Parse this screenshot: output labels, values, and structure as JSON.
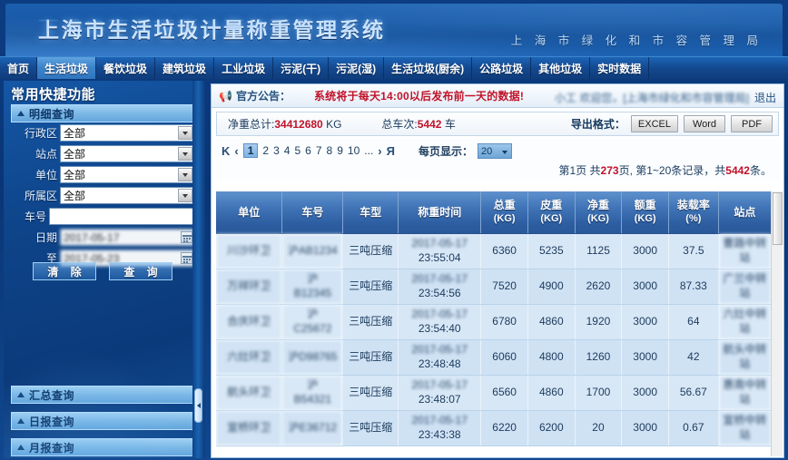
{
  "banner": {
    "title": "上海市生活垃圾计量称重管理系统",
    "org": "上 海 市 绿 化 和 市 容 管 理 局"
  },
  "nav": {
    "items": [
      {
        "label": "首页",
        "active": false
      },
      {
        "label": "生活垃圾",
        "active": true
      },
      {
        "label": "餐饮垃圾",
        "active": false
      },
      {
        "label": "建筑垃圾",
        "active": false
      },
      {
        "label": "工业垃圾",
        "active": false
      },
      {
        "label": "污泥(干)",
        "active": false
      },
      {
        "label": "污泥(湿)",
        "active": false
      },
      {
        "label": "生活垃圾(厨余)",
        "active": false
      },
      {
        "label": "公路垃圾",
        "active": false
      },
      {
        "label": "其他垃圾",
        "active": false
      },
      {
        "label": "实时数据",
        "active": false
      }
    ]
  },
  "sidebar": {
    "title": "常用快捷功能",
    "sections": [
      {
        "label": "明细查询"
      },
      {
        "label": "汇总查询"
      },
      {
        "label": "日报查询"
      },
      {
        "label": "月报查询"
      }
    ],
    "form": {
      "fields": [
        {
          "label": "行政区",
          "value": "全部",
          "type": "select"
        },
        {
          "label": "站点",
          "value": "全部",
          "type": "select"
        },
        {
          "label": "单位",
          "value": "全部",
          "type": "select"
        },
        {
          "label": "所属区",
          "value": "全部",
          "type": "select"
        },
        {
          "label": "车号",
          "value": "",
          "type": "text",
          "placeholder": ""
        },
        {
          "label": "日期",
          "value": "2017-05-17",
          "type": "date"
        },
        {
          "label": "至",
          "value": "2017-05-23",
          "type": "date"
        }
      ],
      "clear_label": "清 除",
      "query_label": "查 询"
    }
  },
  "notice": {
    "label": "官方公告：",
    "message": "系统将于每天14:00以后发布前一天的数据!",
    "user": "小工 欢迎您，[上海市绿化和市容管理局]",
    "logout": "退出",
    "horn_icon": "megaphone-icon"
  },
  "summary": {
    "net_weight_label": "净重总计:",
    "net_weight_value": "34412680",
    "net_weight_unit": "KG",
    "trips_label": "总车次:",
    "trips_value": "5442",
    "trips_unit": "车",
    "export_label": "导出格式：",
    "export_buttons": [
      "EXCEL",
      "Word",
      "PDF"
    ]
  },
  "pager": {
    "first": "K",
    "prev": "‹",
    "pages": [
      "1",
      "2",
      "3",
      "4",
      "5",
      "6",
      "7",
      "8",
      "9",
      "10"
    ],
    "ellipsis": "...",
    "next": "›",
    "last": "Я",
    "current_page": "1",
    "per_page_label": "每页显示：",
    "per_page_value": "20",
    "info_prefix": "第1页 共",
    "info_total_pages": "273",
    "info_mid": "页, 第1~20条记录，共",
    "info_total_records": "5442",
    "info_suffix": "条。"
  },
  "table": {
    "columns": [
      {
        "name": "单位",
        "unit": ""
      },
      {
        "name": "车号",
        "unit": ""
      },
      {
        "name": "车型",
        "unit": ""
      },
      {
        "name": "称重时间",
        "unit": ""
      },
      {
        "name": "总重",
        "unit": "(KG)"
      },
      {
        "name": "皮重",
        "unit": "(KG)"
      },
      {
        "name": "净重",
        "unit": "(KG)"
      },
      {
        "name": "额重",
        "unit": "(KG)"
      },
      {
        "name": "装载率",
        "unit": "(%)"
      },
      {
        "name": "站点",
        "unit": ""
      }
    ],
    "rows": [
      {
        "unit": "川沙环卫",
        "plate": "沪AB1234",
        "model": "三吨压缩",
        "time_date": "2017-05-17",
        "time_clock": "23:55:04",
        "gross": "6360",
        "tare": "5235",
        "net": "1125",
        "rated": "3000",
        "load_rate": "37.5",
        "station": "曹路中转站"
      },
      {
        "unit": "万祥环卫",
        "plate": "沪",
        "plate2": "B12345",
        "model": "三吨压缩",
        "time_date": "2017-05-17",
        "time_clock": "23:54:56",
        "gross": "7520",
        "tare": "4900",
        "net": "2620",
        "rated": "3000",
        "load_rate": "87.33",
        "station": "广兰中转站"
      },
      {
        "unit": "合庆环卫",
        "plate": "沪",
        "plate2": "C25672",
        "model": "三吨压缩",
        "time_date": "2017-05-17",
        "time_clock": "23:54:40",
        "gross": "6780",
        "tare": "4860",
        "net": "1920",
        "rated": "3000",
        "load_rate": "64",
        "station": "六灶中转站"
      },
      {
        "unit": "六灶环卫",
        "plate": "沪D98765",
        "model": "三吨压缩",
        "time_date": "2017-05-17",
        "time_clock": "23:48:48",
        "gross": "6060",
        "tare": "4800",
        "net": "1260",
        "rated": "3000",
        "load_rate": "42",
        "station": "航头中转站"
      },
      {
        "unit": "航头环卫",
        "plate": "沪",
        "plate2": "B54321",
        "model": "三吨压缩",
        "time_date": "2017-05-17",
        "time_clock": "23:48:07",
        "gross": "6560",
        "tare": "4860",
        "net": "1700",
        "rated": "3000",
        "load_rate": "56.67",
        "station": "惠南中转站"
      },
      {
        "unit": "宣桥环卫",
        "plate": "沪E36712",
        "model": "三吨压缩",
        "time_date": "2017-05-17",
        "time_clock": "23:43:38",
        "gross": "6220",
        "tare": "6200",
        "net": "20",
        "rated": "3000",
        "load_rate": "0.67",
        "station": "宣桥中转站"
      }
    ]
  }
}
